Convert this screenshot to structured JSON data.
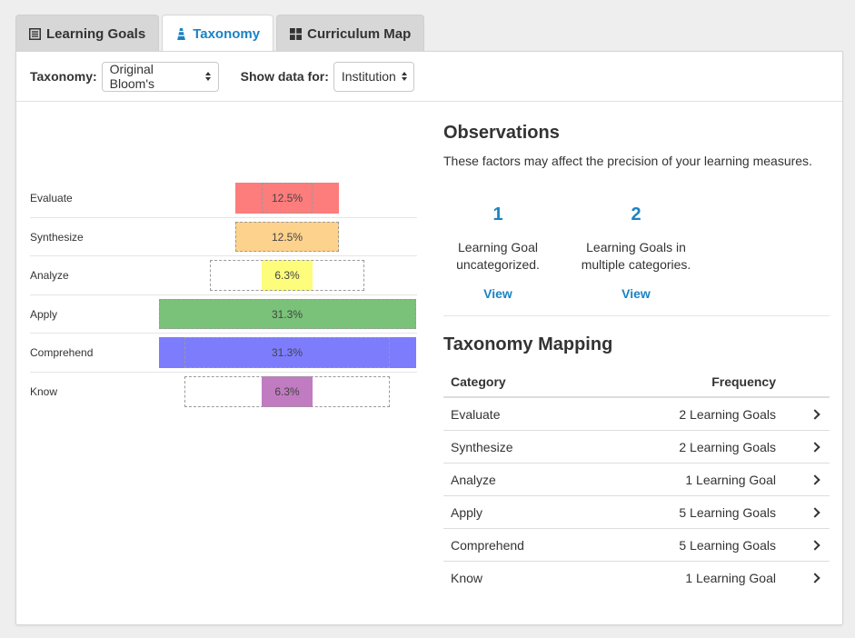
{
  "tabs": [
    {
      "label": "Learning Goals",
      "icon": "list-icon",
      "active": false
    },
    {
      "label": "Taxonomy",
      "icon": "pyramid-icon",
      "active": true
    },
    {
      "label": "Curriculum Map",
      "icon": "grid-icon",
      "active": false
    }
  ],
  "toolbar": {
    "taxonomy_label": "Taxonomy:",
    "taxonomy_value": "Original Bloom's",
    "show_data_label": "Show data for:",
    "show_data_value": "Institution"
  },
  "chart_data": {
    "type": "bar",
    "categories": [
      "Evaluate",
      "Synthesize",
      "Analyze",
      "Apply",
      "Comprehend",
      "Know"
    ],
    "values": [
      12.5,
      12.5,
      6.3,
      31.3,
      31.3,
      6.3
    ],
    "value_labels": [
      "12.5%",
      "12.5%",
      "6.3%",
      "31.3%",
      "31.3%",
      "6.3%"
    ],
    "reference_values": [
      6.3,
      12.5,
      18.8,
      31.3,
      25.0,
      25.0
    ],
    "colors": [
      "#fd7c7c",
      "#fdd28c",
      "#fdfc7b",
      "#7ac179",
      "#7c7cfd",
      "#c17bc1"
    ]
  },
  "observations": {
    "title": "Observations",
    "subtitle": "These factors may affect the precision of your learning measures.",
    "items": [
      {
        "count": "1",
        "text_line1": "Learning Goal",
        "text_line2": "uncategorized.",
        "link": "View"
      },
      {
        "count": "2",
        "text_line1": "Learning Goals in",
        "text_line2": "multiple categories.",
        "link": "View"
      }
    ]
  },
  "mapping": {
    "title": "Taxonomy Mapping",
    "headers": {
      "category": "Category",
      "frequency": "Frequency"
    },
    "rows": [
      {
        "category": "Evaluate",
        "frequency": "2 Learning Goals"
      },
      {
        "category": "Synthesize",
        "frequency": "2 Learning Goals"
      },
      {
        "category": "Analyze",
        "frequency": "1 Learning Goal"
      },
      {
        "category": "Apply",
        "frequency": "5 Learning Goals"
      },
      {
        "category": "Comprehend",
        "frequency": "5 Learning Goals"
      },
      {
        "category": "Know",
        "frequency": "1 Learning Goal"
      }
    ]
  },
  "colors": {
    "accent": "#1b83c4"
  }
}
